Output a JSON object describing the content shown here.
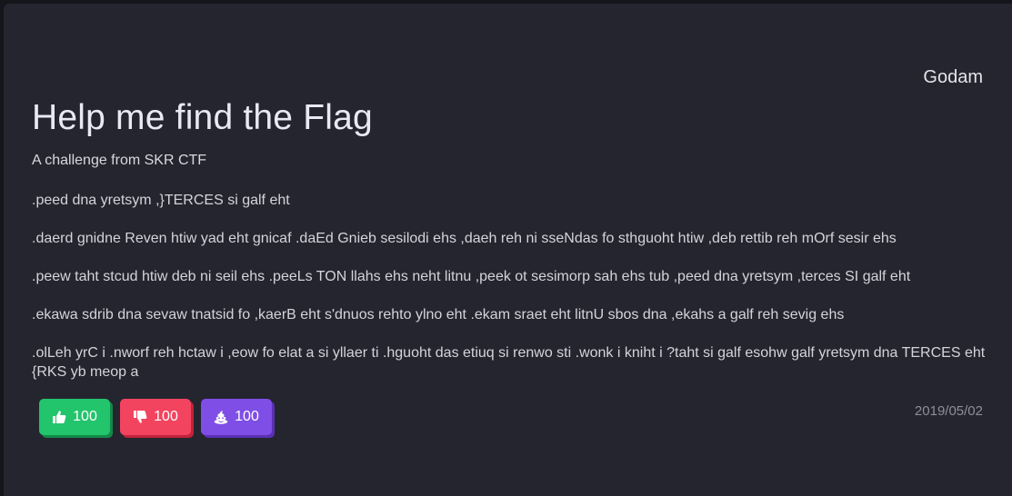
{
  "post": {
    "author": "Godam",
    "title": "Help me find the Flag",
    "subtitle": "A challenge from SKR CTF",
    "paragraphs": [
      ".peed dna yretsym ,}TERCES si galf eht",
      ".daerd gnidne Reven htiw yad eht gnicaf .daEd Gnieb sesilodi ehs ,daeh reh ni sseNdas fo sthguoht htiw ,deb rettib reh mOrf sesir ehs",
      ".peew taht stcud htiw deb ni seil ehs .peeLs TON llahs ehs neht litnu ,peek ot sesimorp sah ehs tub ,peed dna yretsym ,terces SI galf eht",
      ".ekawa sdrib dna sevaw tnatsid fo ,kaerB eht s'dnuos rehto ylno eht .ekam sraet eht litnU sbos dna ,ekahs a galf reh sevig ehs",
      ".olLeh yrC i .nworf reh hctaw i ,eow fo elat a si yllaer ti .hguoht das etiuq si renwo sti .wonk i kniht i ?taht si galf esohw galf yretsym dna TERCES eht\n{RKS yb meop a"
    ],
    "date": "2019/05/02"
  },
  "reactions": {
    "like": {
      "count": "100",
      "icon": "thumbs-up-icon",
      "color": "#22c46c"
    },
    "dislike": {
      "count": "100",
      "icon": "thumbs-down-icon",
      "color": "#f2445f"
    },
    "poop": {
      "count": "100",
      "icon": "poop-icon",
      "color": "#7f4ee6"
    }
  }
}
